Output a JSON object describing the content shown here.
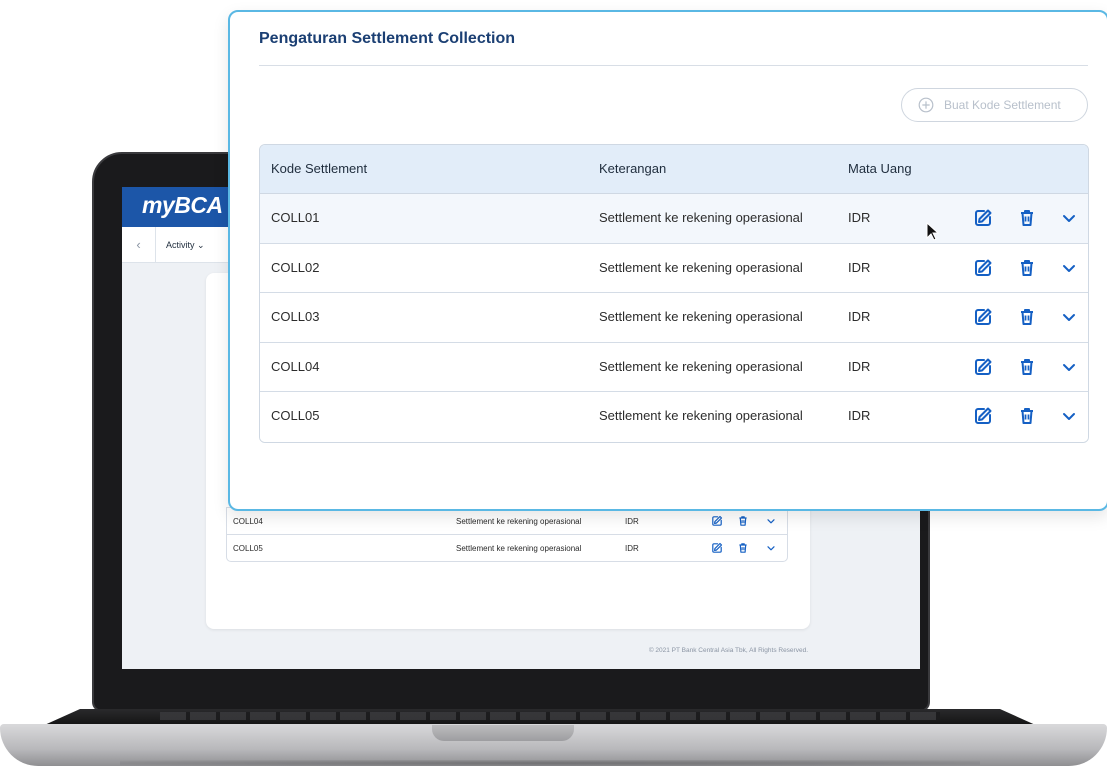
{
  "laptop_app": {
    "logo": "myBCA",
    "nav": {
      "back_icon": "chevron-left-icon",
      "activity_label": "Activity ⌄"
    },
    "rows": [
      {
        "code": "COLL04",
        "desc": "Settlement ke rekening operasional",
        "currency": "IDR"
      },
      {
        "code": "COLL05",
        "desc": "Settlement ke rekening operasional",
        "currency": "IDR"
      }
    ],
    "footer": "© 2021 PT Bank Central Asia Tbk, All Rights Reserved."
  },
  "panel": {
    "title": "Pengaturan Settlement Collection",
    "create_button": {
      "label": "Buat Kode Settlement",
      "icon": "plus-circle-icon",
      "disabled": true
    },
    "table": {
      "headers": {
        "code": "Kode Settlement",
        "desc": "Keterangan",
        "currency": "Mata Uang"
      },
      "rows": [
        {
          "code": "COLL01",
          "desc": "Settlement ke rekening operasional",
          "currency": "IDR"
        },
        {
          "code": "COLL02",
          "desc": "Settlement ke rekening operasional",
          "currency": "IDR"
        },
        {
          "code": "COLL03",
          "desc": "Settlement ke rekening operasional",
          "currency": "IDR"
        },
        {
          "code": "COLL04",
          "desc": "Settlement ke rekening operasional",
          "currency": "IDR"
        },
        {
          "code": "COLL05",
          "desc": "Settlement ke rekening operasional",
          "currency": "IDR"
        }
      ],
      "row_actions": [
        "edit-icon",
        "trash-icon",
        "chevron-down-icon"
      ]
    }
  },
  "colors": {
    "brand_blue": "#1c56a8",
    "title_navy": "#1b3f73",
    "icon_blue": "#1560c4",
    "panel_border": "#5ab8e4",
    "header_bg": "#e2edf9"
  }
}
